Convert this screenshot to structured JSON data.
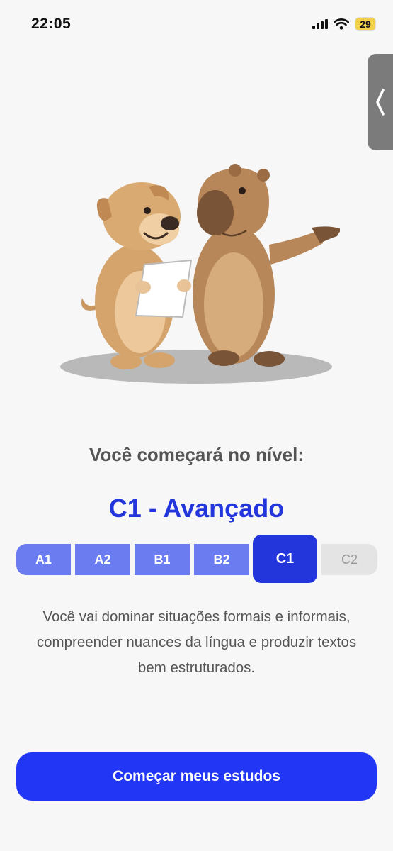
{
  "status_bar": {
    "time": "22:05",
    "battery": "29",
    "icons": [
      "signal-icon",
      "wifi-icon",
      "battery-icon"
    ]
  },
  "side_handle": {
    "icon": "chevron-left-icon"
  },
  "illustration": {
    "description_icon": "dog-and-capybara-illustration"
  },
  "headline": "Você começará no nível:",
  "level_title": "C1 - Avançado",
  "levels": {
    "a1": "A1",
    "a2": "A2",
    "b1": "B1",
    "b2": "B2",
    "c1": "C1",
    "c2": "C2",
    "selected": "C1"
  },
  "description": "Você vai dominar situações formais e informais, compreender nuances da língua e produzir textos bem estruturados.",
  "cta": {
    "label": "Começar meus estudos"
  },
  "colors": {
    "accent": "#2236dc",
    "button": "#2137f5",
    "segment_done": "#6b7cf0",
    "segment_locked": "#e4e4e4",
    "battery": "#f2d24b"
  }
}
